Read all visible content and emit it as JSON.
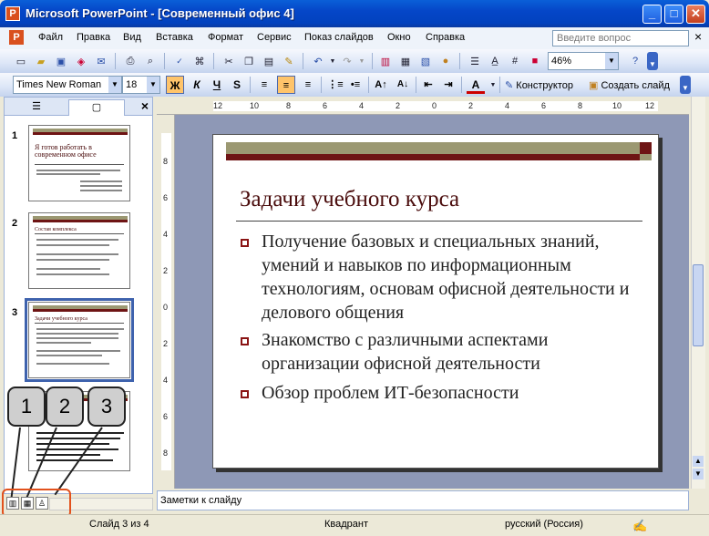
{
  "window": {
    "title": "Microsoft PowerPoint - [Современный офис 4]",
    "icon_letter": "P"
  },
  "window_controls": {
    "minimize": "_",
    "maximize": "□",
    "close": "✕"
  },
  "menu": {
    "items": [
      "Файл",
      "Правка",
      "Вид",
      "Вставка",
      "Формат",
      "Сервис",
      "Показ слайдов",
      "Окно",
      "Справка"
    ],
    "help_placeholder": "Введите вопрос",
    "close_doc": "×"
  },
  "standard_toolbar": {
    "zoom": "46%"
  },
  "formatting_toolbar": {
    "font": "Times New Roman",
    "size": "18",
    "bold": "Ж",
    "italic": "К",
    "underline": "Ч",
    "shadow": "S",
    "designer_label": "Конструктор",
    "new_slide_label": "Создать слайд"
  },
  "left_panel": {
    "tab_outline": "☰",
    "tab_slides": "▢",
    "close": "×",
    "thumbnails": [
      {
        "number": "1",
        "title": "Я готов работать в современном офисе"
      },
      {
        "number": "2",
        "title": "Состав комплекса"
      },
      {
        "number": "3",
        "title": "Задачи учебного курса"
      },
      {
        "number": "4",
        "title": ""
      }
    ]
  },
  "slide": {
    "title": "Задачи учебного курса",
    "bullets": [
      "Получение базовых и специальных знаний, умений и навыков по информационным технологиям, основам офисной деятельности и делового общения",
      "Знакомство с различными аспектами организации офисной деятельности",
      "Обзор проблем ИТ-безопасности"
    ]
  },
  "rulers": {
    "horizontal": [
      "12",
      "10",
      "8",
      "6",
      "4",
      "2",
      "0",
      "2",
      "4",
      "6",
      "8",
      "10",
      "12"
    ],
    "vertical": [
      "8",
      "6",
      "4",
      "2",
      "0",
      "2",
      "4",
      "6",
      "8"
    ]
  },
  "notes": {
    "placeholder": "Заметки к слайду"
  },
  "status": {
    "slide": "Слайд 3 из 4",
    "design": "Квадрант",
    "language": "русский (Россия)"
  },
  "callouts": [
    "1",
    "2",
    "3"
  ],
  "colors": {
    "accent_dark_red": "#6E1414",
    "olive_bar": "#9B9872",
    "title_blue": "#0A5FD8"
  }
}
